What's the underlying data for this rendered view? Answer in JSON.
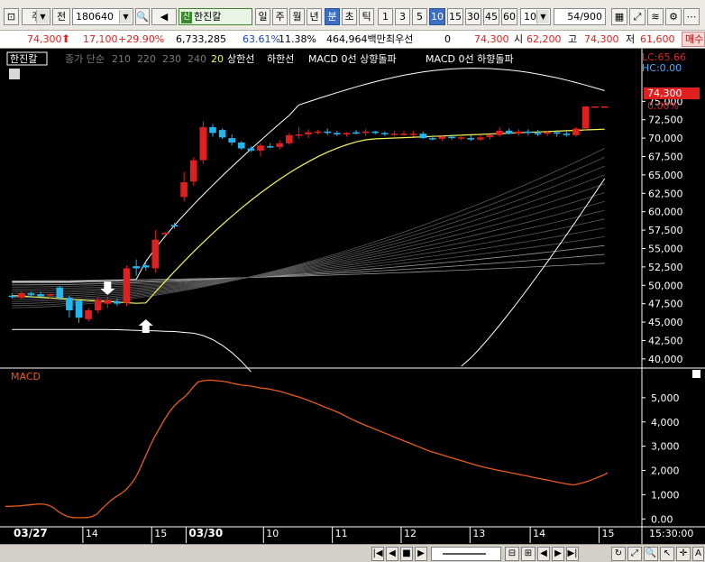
{
  "toolbar": {
    "market_type": "주",
    "prefix_label": "전",
    "stock_code": "180640",
    "stock_badge": "신",
    "stock_name": "한진칼",
    "period_tabs": [
      "일",
      "주",
      "월",
      "년",
      "분",
      "초",
      "틱"
    ],
    "active_period": "분",
    "interval_buttons": [
      "1",
      "3",
      "5",
      "10",
      "15",
      "30",
      "45",
      "60"
    ],
    "active_interval": "10",
    "interval_select": "10",
    "count_value": "54",
    "count_total": "/900"
  },
  "price_info": {
    "price": "74,300",
    "change": "17,100",
    "change_pct": "+29.90%",
    "volume": "6,733,285",
    "ratio": "63.61%",
    "turnover": "11.38%",
    "amount": "464,964백만",
    "best_label": "최우선",
    "best_value": "0",
    "last": "74,300",
    "open_label": "시",
    "open_value": "62,200",
    "high_label": "고",
    "high_value": "74,300",
    "low_label": "저",
    "low_value": "61,600",
    "trade_button": "매수"
  },
  "legend": {
    "name": "한진칼",
    "ma_prefix": "종가 단순",
    "ma_periods": [
      "210",
      "220",
      "230",
      "240"
    ],
    "ma20": "20",
    "upper": "상한선",
    "lower": "하한선",
    "macd_up": "MACD 0선 상향돌파",
    "macd_down": "MACD 0선 하향돌파",
    "lc": "LC:65.66",
    "hc": "HC:0.00",
    "last_price_tag": "74,300",
    "last_pct_tag": "0.00%",
    "macd_title": "MACD"
  },
  "colors": {
    "up": "#e02020",
    "down": "#22b6f0",
    "ma20": "#f4f45a",
    "band": "#ffffff",
    "macd": "#e85a1e",
    "axis_text": "#ffffff",
    "lc": "#e02020"
  },
  "chart_data": [
    {
      "type": "candlestick",
      "title": "",
      "ylim": [
        39000,
        77000
      ],
      "y_ticks": [
        "75,000",
        "72,500",
        "70,000",
        "67,500",
        "65,000",
        "62,500",
        "60,000",
        "57,500",
        "55,000",
        "52,500",
        "50,000",
        "47,500",
        "45,000",
        "42,500",
        "40,000"
      ],
      "y_tick_values": [
        75000,
        72500,
        70000,
        67500,
        65000,
        62500,
        60000,
        57500,
        55000,
        52500,
        50000,
        47500,
        45000,
        42500,
        40000
      ],
      "candles": [
        {
          "o": 48600,
          "h": 48900,
          "l": 48200,
          "c": 48400
        },
        {
          "o": 48300,
          "h": 49200,
          "l": 48100,
          "c": 48900
        },
        {
          "o": 48900,
          "h": 49100,
          "l": 48300,
          "c": 48700
        },
        {
          "o": 48800,
          "h": 49100,
          "l": 48400,
          "c": 48500
        },
        {
          "o": 48600,
          "h": 48900,
          "l": 48200,
          "c": 48800
        },
        {
          "o": 49700,
          "h": 49900,
          "l": 48000,
          "c": 48300
        },
        {
          "o": 48300,
          "h": 48600,
          "l": 45600,
          "c": 46600
        },
        {
          "o": 47900,
          "h": 48200,
          "l": 44900,
          "c": 45600
        },
        {
          "o": 45400,
          "h": 46900,
          "l": 45100,
          "c": 46600
        },
        {
          "o": 46600,
          "h": 48400,
          "l": 46200,
          "c": 48000
        },
        {
          "o": 47500,
          "h": 48400,
          "l": 46900,
          "c": 48000
        },
        {
          "o": 47800,
          "h": 48200,
          "l": 47200,
          "c": 47500
        },
        {
          "o": 47600,
          "h": 52700,
          "l": 47200,
          "c": 52300
        },
        {
          "o": 52600,
          "h": 53500,
          "l": 51300,
          "c": 52300
        },
        {
          "o": 52700,
          "h": 53200,
          "l": 52000,
          "c": 52400
        },
        {
          "o": 52300,
          "h": 57500,
          "l": 51700,
          "c": 56200
        },
        {
          "o": 57100,
          "h": 57300,
          "l": 56900,
          "c": 57100
        },
        {
          "o": 58200,
          "h": 58500,
          "l": 57700,
          "c": 58000
        },
        {
          "o": 62000,
          "h": 65400,
          "l": 61400,
          "c": 64000
        },
        {
          "o": 64100,
          "h": 67400,
          "l": 63500,
          "c": 67000
        },
        {
          "o": 67000,
          "h": 72300,
          "l": 66500,
          "c": 71500
        },
        {
          "o": 71500,
          "h": 71900,
          "l": 70200,
          "c": 70700
        },
        {
          "o": 71100,
          "h": 71300,
          "l": 69900,
          "c": 70100
        },
        {
          "o": 70000,
          "h": 70500,
          "l": 69000,
          "c": 69400
        },
        {
          "o": 69400,
          "h": 69600,
          "l": 68400,
          "c": 68600
        },
        {
          "o": 68600,
          "h": 68900,
          "l": 68100,
          "c": 68300
        },
        {
          "o": 68300,
          "h": 69300,
          "l": 67500,
          "c": 69000
        },
        {
          "o": 68900,
          "h": 69300,
          "l": 68600,
          "c": 68800
        },
        {
          "o": 68800,
          "h": 69700,
          "l": 68500,
          "c": 69300
        },
        {
          "o": 69300,
          "h": 70700,
          "l": 69100,
          "c": 70400
        },
        {
          "o": 70400,
          "h": 71500,
          "l": 69900,
          "c": 70500
        },
        {
          "o": 70500,
          "h": 71200,
          "l": 70000,
          "c": 70800
        },
        {
          "o": 70800,
          "h": 71100,
          "l": 70500,
          "c": 70900
        },
        {
          "o": 70900,
          "h": 71300,
          "l": 70400,
          "c": 70700
        },
        {
          "o": 70700,
          "h": 71000,
          "l": 70300,
          "c": 70500
        },
        {
          "o": 70500,
          "h": 70800,
          "l": 70200,
          "c": 70700
        },
        {
          "o": 70800,
          "h": 71100,
          "l": 70500,
          "c": 70600
        },
        {
          "o": 70700,
          "h": 71200,
          "l": 70300,
          "c": 70900
        },
        {
          "o": 70900,
          "h": 71000,
          "l": 70500,
          "c": 70700
        },
        {
          "o": 70700,
          "h": 70900,
          "l": 70300,
          "c": 70600
        },
        {
          "o": 70600,
          "h": 71000,
          "l": 70200,
          "c": 70600
        },
        {
          "o": 70500,
          "h": 71000,
          "l": 70300,
          "c": 70600
        },
        {
          "o": 70600,
          "h": 71000,
          "l": 70200,
          "c": 70600
        },
        {
          "o": 70600,
          "h": 70900,
          "l": 69900,
          "c": 70000
        },
        {
          "o": 70000,
          "h": 70400,
          "l": 69700,
          "c": 69900
        },
        {
          "o": 69900,
          "h": 70300,
          "l": 69600,
          "c": 70200
        },
        {
          "o": 70200,
          "h": 70500,
          "l": 69800,
          "c": 70000
        },
        {
          "o": 70000,
          "h": 70400,
          "l": 69700,
          "c": 70100
        },
        {
          "o": 70000,
          "h": 70400,
          "l": 69600,
          "c": 69800
        },
        {
          "o": 69800,
          "h": 70400,
          "l": 69600,
          "c": 70100
        },
        {
          "o": 70100,
          "h": 70500,
          "l": 69800,
          "c": 70400
        },
        {
          "o": 70400,
          "h": 71500,
          "l": 70200,
          "c": 71000
        },
        {
          "o": 71000,
          "h": 71300,
          "l": 70500,
          "c": 70600
        },
        {
          "o": 70600,
          "h": 71200,
          "l": 70300,
          "c": 70900
        },
        {
          "o": 70900,
          "h": 71200,
          "l": 70400,
          "c": 70700
        },
        {
          "o": 70700,
          "h": 71100,
          "l": 70300,
          "c": 70600
        },
        {
          "o": 70600,
          "h": 71000,
          "l": 70300,
          "c": 70800
        },
        {
          "o": 70800,
          "h": 71100,
          "l": 70200,
          "c": 70600
        },
        {
          "o": 70600,
          "h": 70900,
          "l": 70200,
          "c": 70500
        },
        {
          "o": 70400,
          "h": 71500,
          "l": 70200,
          "c": 71300
        },
        {
          "o": 71300,
          "h": 74300,
          "l": 71000,
          "c": 74300
        },
        {
          "o": 74300,
          "h": 74300,
          "l": 74300,
          "c": 74300
        },
        {
          "o": 74300,
          "h": 74300,
          "l": 74300,
          "c": 74300
        }
      ],
      "x_labels": [
        "03/27",
        "14",
        "15",
        "03/30",
        "10",
        "11",
        "12",
        "13",
        "14",
        "15"
      ],
      "x_label_indices": [
        0,
        9,
        17,
        21,
        30,
        38,
        46,
        54,
        61,
        69
      ],
      "signals": [
        {
          "index": 10,
          "dir": "down",
          "label": "MACD 0선 하향돌파"
        },
        {
          "index": 14,
          "dir": "up",
          "label": "MACD 0선 상향돌파"
        }
      ]
    },
    {
      "type": "line",
      "title": "MACD",
      "series": [
        {
          "name": "MACD",
          "values": [
            520,
            520,
            530,
            540,
            560,
            580,
            600,
            620,
            610,
            560,
            460,
            300,
            180,
            90,
            60,
            50,
            50,
            60,
            100,
            200,
            420,
            600,
            780,
            920,
            1050,
            1200,
            1420,
            1700,
            2100,
            2550,
            3000,
            3400,
            3750,
            4100,
            4400,
            4650,
            4850,
            5000,
            5200,
            5450,
            5650,
            5700,
            5720,
            5720,
            5700,
            5680,
            5650,
            5600,
            5560,
            5520,
            5500,
            5480,
            5440,
            5400,
            5380,
            5350,
            5300,
            5260,
            5200,
            5140,
            5080,
            5020,
            4950,
            4880,
            4800,
            4720,
            4640,
            4560,
            4480,
            4400,
            4300,
            4200,
            4100,
            4010,
            3920,
            3840,
            3760,
            3680,
            3600,
            3520,
            3440,
            3360,
            3280,
            3200,
            3120,
            3040,
            2960,
            2880,
            2800,
            2740,
            2680,
            2620,
            2560,
            2500,
            2440,
            2380,
            2320,
            2260,
            2200,
            2150,
            2100,
            2060,
            2020,
            1980,
            1940,
            1900,
            1860,
            1820,
            1780,
            1740,
            1700,
            1660,
            1620,
            1580,
            1540,
            1500,
            1460,
            1430,
            1400,
            1450,
            1500,
            1560,
            1640,
            1720,
            1800,
            1900
          ]
        }
      ],
      "y_ticks": [
        "5,000",
        "4,000",
        "3,000",
        "2,000",
        "1,000",
        "0.00"
      ],
      "y_tick_values": [
        5000,
        4000,
        3000,
        2000,
        1000,
        0
      ],
      "ylim": [
        -250,
        6000
      ]
    }
  ],
  "time_label": "15:30:00",
  "bottombar": {
    "nav_buttons": [
      "◀",
      "▶",
      "■",
      "▶",
      "◀",
      "▶"
    ]
  }
}
